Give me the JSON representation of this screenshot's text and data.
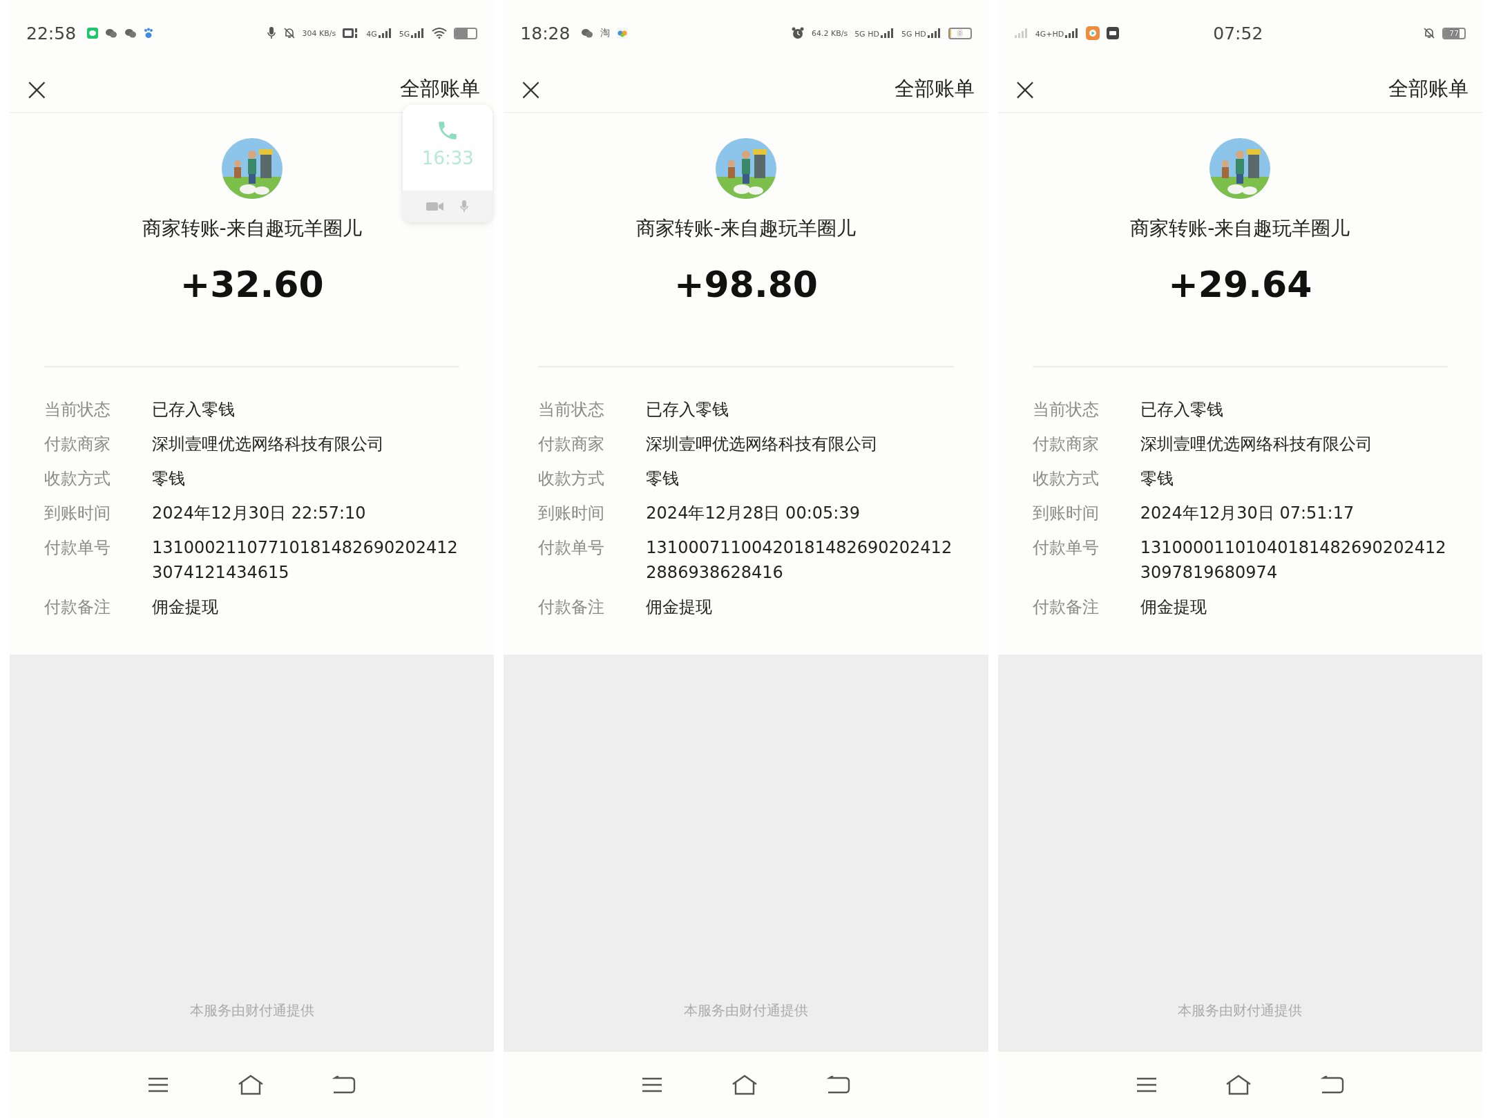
{
  "phones": [
    {
      "status_bar": {
        "time": "22:58",
        "kind": "time-left",
        "left_icons": [
          {
            "kind": "green-app"
          },
          {
            "kind": "chat"
          },
          {
            "kind": "chat"
          },
          {
            "kind": "paw"
          }
        ],
        "right_icons": [
          {
            "kind": "mic"
          },
          {
            "kind": "bell-off"
          },
          {
            "kind": "speed",
            "text": "304 KB/s"
          },
          {
            "kind": "hd"
          },
          {
            "kind": "signal",
            "text": "4G"
          },
          {
            "kind": "signal",
            "text": "5G"
          },
          {
            "kind": "wifi"
          },
          {
            "kind": "battery",
            "level": 0.6
          }
        ]
      },
      "header": {
        "close": "×",
        "title": "全部账单"
      },
      "call_widget": {
        "time": "16:33"
      },
      "merchant": "商家转账-来自趣玩羊圈儿",
      "amount": "+32.60",
      "details": [
        {
          "label": "当前状态",
          "value": "已存入零钱"
        },
        {
          "label": "付款商家",
          "value": "深圳壹哩优选网络科技有限公司"
        },
        {
          "label": "收款方式",
          "value": "零钱"
        },
        {
          "label": "到账时间",
          "value": "2024年12月30日 22:57:10"
        },
        {
          "label": "付款单号",
          "value": "131000211077101814826902024123074121434615"
        },
        {
          "label": "付款备注",
          "value": "佣金提现"
        }
      ],
      "footer": "本服务由财付通提供"
    },
    {
      "status_bar": {
        "time": "18:28",
        "kind": "time-left",
        "left_icons": [
          {
            "kind": "chat"
          },
          {
            "kind": "glyph",
            "text": "淘"
          },
          {
            "kind": "color-app"
          }
        ],
        "right_icons": [
          {
            "kind": "alarm"
          },
          {
            "kind": "speed",
            "text": "64.2 KB/s"
          },
          {
            "kind": "signal",
            "text": "5G HD"
          },
          {
            "kind": "signal",
            "text": "5G HD"
          },
          {
            "kind": "battery",
            "text": "8",
            "level": 0.08
          }
        ]
      },
      "header": {
        "close": "×",
        "title": "全部账单"
      },
      "merchant": "商家转账-来自趣玩羊圈儿",
      "amount": "+98.80",
      "details": [
        {
          "label": "当前状态",
          "value": "已存入零钱"
        },
        {
          "label": "付款商家",
          "value": "深圳壹呷优选网络科技有限公司"
        },
        {
          "label": "收款方式",
          "value": "零钱"
        },
        {
          "label": "到账时间",
          "value": "2024年12月28日 00:05:39"
        },
        {
          "label": "付款单号",
          "value": "131000711004201814826902024122886938628416"
        },
        {
          "label": "付款备注",
          "value": "佣金提现"
        }
      ],
      "footer": "本服务由财付通提供"
    },
    {
      "status_bar": {
        "time": "07:52",
        "kind": "time-center",
        "left_icons": [
          {
            "kind": "signal"
          },
          {
            "kind": "signal",
            "text": "4G+HD"
          },
          {
            "kind": "orange-app"
          },
          {
            "kind": "dark-app"
          }
        ],
        "right_icons": [
          {
            "kind": "bell-off"
          },
          {
            "kind": "battery",
            "text": "77",
            "level": 0.77
          }
        ]
      },
      "header": {
        "close": "×",
        "title": "全部账单"
      },
      "merchant": "商家转账-来自趣玩羊圈儿",
      "amount": "+29.64",
      "details": [
        {
          "label": "当前状态",
          "value": "已存入零钱"
        },
        {
          "label": "付款商家",
          "value": "深圳壹哩优选网络科技有限公司"
        },
        {
          "label": "收款方式",
          "value": "零钱"
        },
        {
          "label": "到账时间",
          "value": "2024年12月30日 07:51:17"
        },
        {
          "label": "付款单号",
          "value": "131000011010401814826902024123097819680974"
        },
        {
          "label": "付款备注",
          "value": "佣金提现"
        }
      ],
      "footer": "本服务由财付通提供"
    }
  ]
}
